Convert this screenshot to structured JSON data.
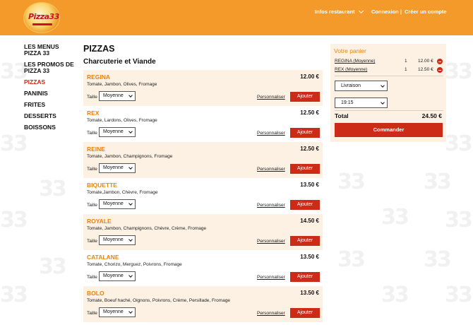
{
  "header": {
    "logo_label": "Pizza33",
    "infos_label": "Infos restaurant",
    "login_label": "Connexion |",
    "register_label": "Créer un compte",
    "brand_color": "#f39a2b"
  },
  "sidebar": {
    "items": [
      {
        "label": "LES MENUS PIZZA 33",
        "active": false
      },
      {
        "label": "LES PROMOS DE PIZZA 33",
        "active": false
      },
      {
        "label": "PIZZAS",
        "active": true
      },
      {
        "label": "PANINIS",
        "active": false
      },
      {
        "label": "FRITES",
        "active": false
      },
      {
        "label": "DESSERTS",
        "active": false
      },
      {
        "label": "BOISSONS",
        "active": false
      }
    ]
  },
  "main": {
    "title": "PIZZAS",
    "section": "Charcuterie et Viande",
    "size_label": "Taille",
    "customize_label": "Personnaliser",
    "add_label": "Ajouter",
    "products": [
      {
        "name": "REGINA",
        "price": "12.00 €",
        "desc": "Tomate, Jambon, Olives, Fromage",
        "size": "Moyenne"
      },
      {
        "name": "REX",
        "price": "12.50 €",
        "desc": "Tomate, Lardons, Olives, Fromage",
        "size": "Moyenne"
      },
      {
        "name": "REINE",
        "price": "12.50 €",
        "desc": "Tomate, Jambon, Champignons, Fromage",
        "size": "Moyenne"
      },
      {
        "name": "BIQUETTE",
        "price": "13.50 €",
        "desc": "Tomate,Jambon, Chèvre, Fromage",
        "size": "Moyenne"
      },
      {
        "name": "ROYALE",
        "price": "14.50 €",
        "desc": "Tomate, Jambon, Champignons, Chèvre, Crème, Fromage",
        "size": "Moyenne"
      },
      {
        "name": "CATALANE",
        "price": "13.50 €",
        "desc": "Tomate, Chorizo, Merguez, Poivrons, Fromage",
        "size": "Moyenne"
      },
      {
        "name": "BOLO",
        "price": "13.50 €",
        "desc": "Tomate, Boeuf haché, Oignons, Poivrons, Crème, Persillade, Fromage",
        "size": "Moyenne"
      }
    ]
  },
  "cart": {
    "title": "Votre panier",
    "lines": [
      {
        "name": "REGINA (Moyenne)",
        "qty": "1",
        "price": "12.00 €"
      },
      {
        "name": "REX (Moyenne)",
        "qty": "1",
        "price": "12.50 €"
      }
    ],
    "mode": "Livraison",
    "time": "19:15",
    "total_label": "Total",
    "total_value": "24.50 €",
    "order_label": "Commander"
  }
}
